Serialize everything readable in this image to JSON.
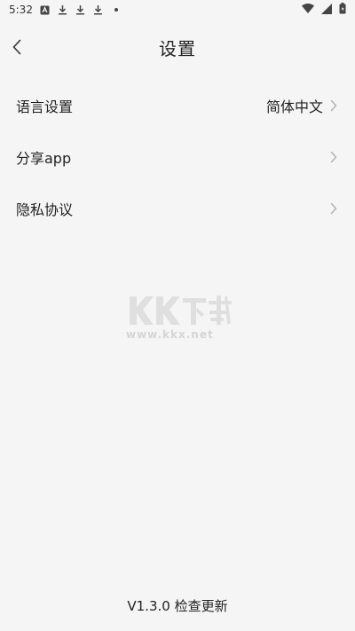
{
  "status_bar": {
    "time": "5:32"
  },
  "header": {
    "title": "设置"
  },
  "menu": {
    "items": [
      {
        "label": "语言设置",
        "value": "简体中文"
      },
      {
        "label": "分享app",
        "value": ""
      },
      {
        "label": "隐私协议",
        "value": ""
      }
    ]
  },
  "watermark": {
    "text": "KK下载",
    "url": "www.kkx.net"
  },
  "footer": {
    "version": "V1.3.0",
    "update_label": "检查更新"
  },
  "colors": {
    "background": "#f5f5f5",
    "text": "#222222",
    "chevron": "#b0b0b0"
  },
  "icons": {
    "back": "chevron-left-icon",
    "item_arrow": "chevron-right-icon"
  }
}
